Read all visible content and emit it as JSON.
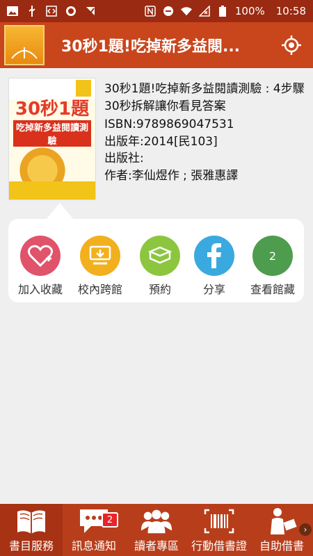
{
  "status_bar": {
    "battery": "100%",
    "time": "10:58"
  },
  "app_bar": {
    "title": "30秒1題!吃掉新多益閱..."
  },
  "book": {
    "title": "30秒1題!吃掉新多益閱讀測驗 : 4步驟30秒拆解讓你看見答案",
    "isbn": "ISBN:9789869047531",
    "year": "出版年:2014[民103]",
    "publisher": "出版社:",
    "author": "作者:李仙煜作 ; 張雅惠譯",
    "cover": {
      "title_line1": "30秒1題",
      "title_line2": "吃掉新多益閱讀測驗"
    }
  },
  "actions": [
    {
      "label": "加入收藏",
      "icon": "heart-plus-icon",
      "color": "#e0536a"
    },
    {
      "label": "校內跨館",
      "icon": "download-icon",
      "color": "#f2b01e"
    },
    {
      "label": "預約",
      "icon": "book-icon",
      "color": "#8cc63f"
    },
    {
      "label": "分享",
      "icon": "facebook-icon",
      "color": "#3aa9e0"
    },
    {
      "label": "查看館藏",
      "icon": "count-icon",
      "color": "#4e9d4e",
      "count": "2"
    }
  ],
  "bottom_nav": [
    {
      "label": "書目服務",
      "icon": "open-book-icon"
    },
    {
      "label": "訊息通知",
      "icon": "chat-icon",
      "badge": "2"
    },
    {
      "label": "讀者專區",
      "icon": "users-icon"
    },
    {
      "label": "行動借書證",
      "icon": "barcode-icon"
    },
    {
      "label": "自助借書",
      "icon": "self-checkout-icon"
    }
  ],
  "colors": {
    "status_bar": "#9a2a12",
    "app_bar": "#c9451c",
    "bottom_nav": "#b83e1b",
    "background": "#efefef"
  }
}
